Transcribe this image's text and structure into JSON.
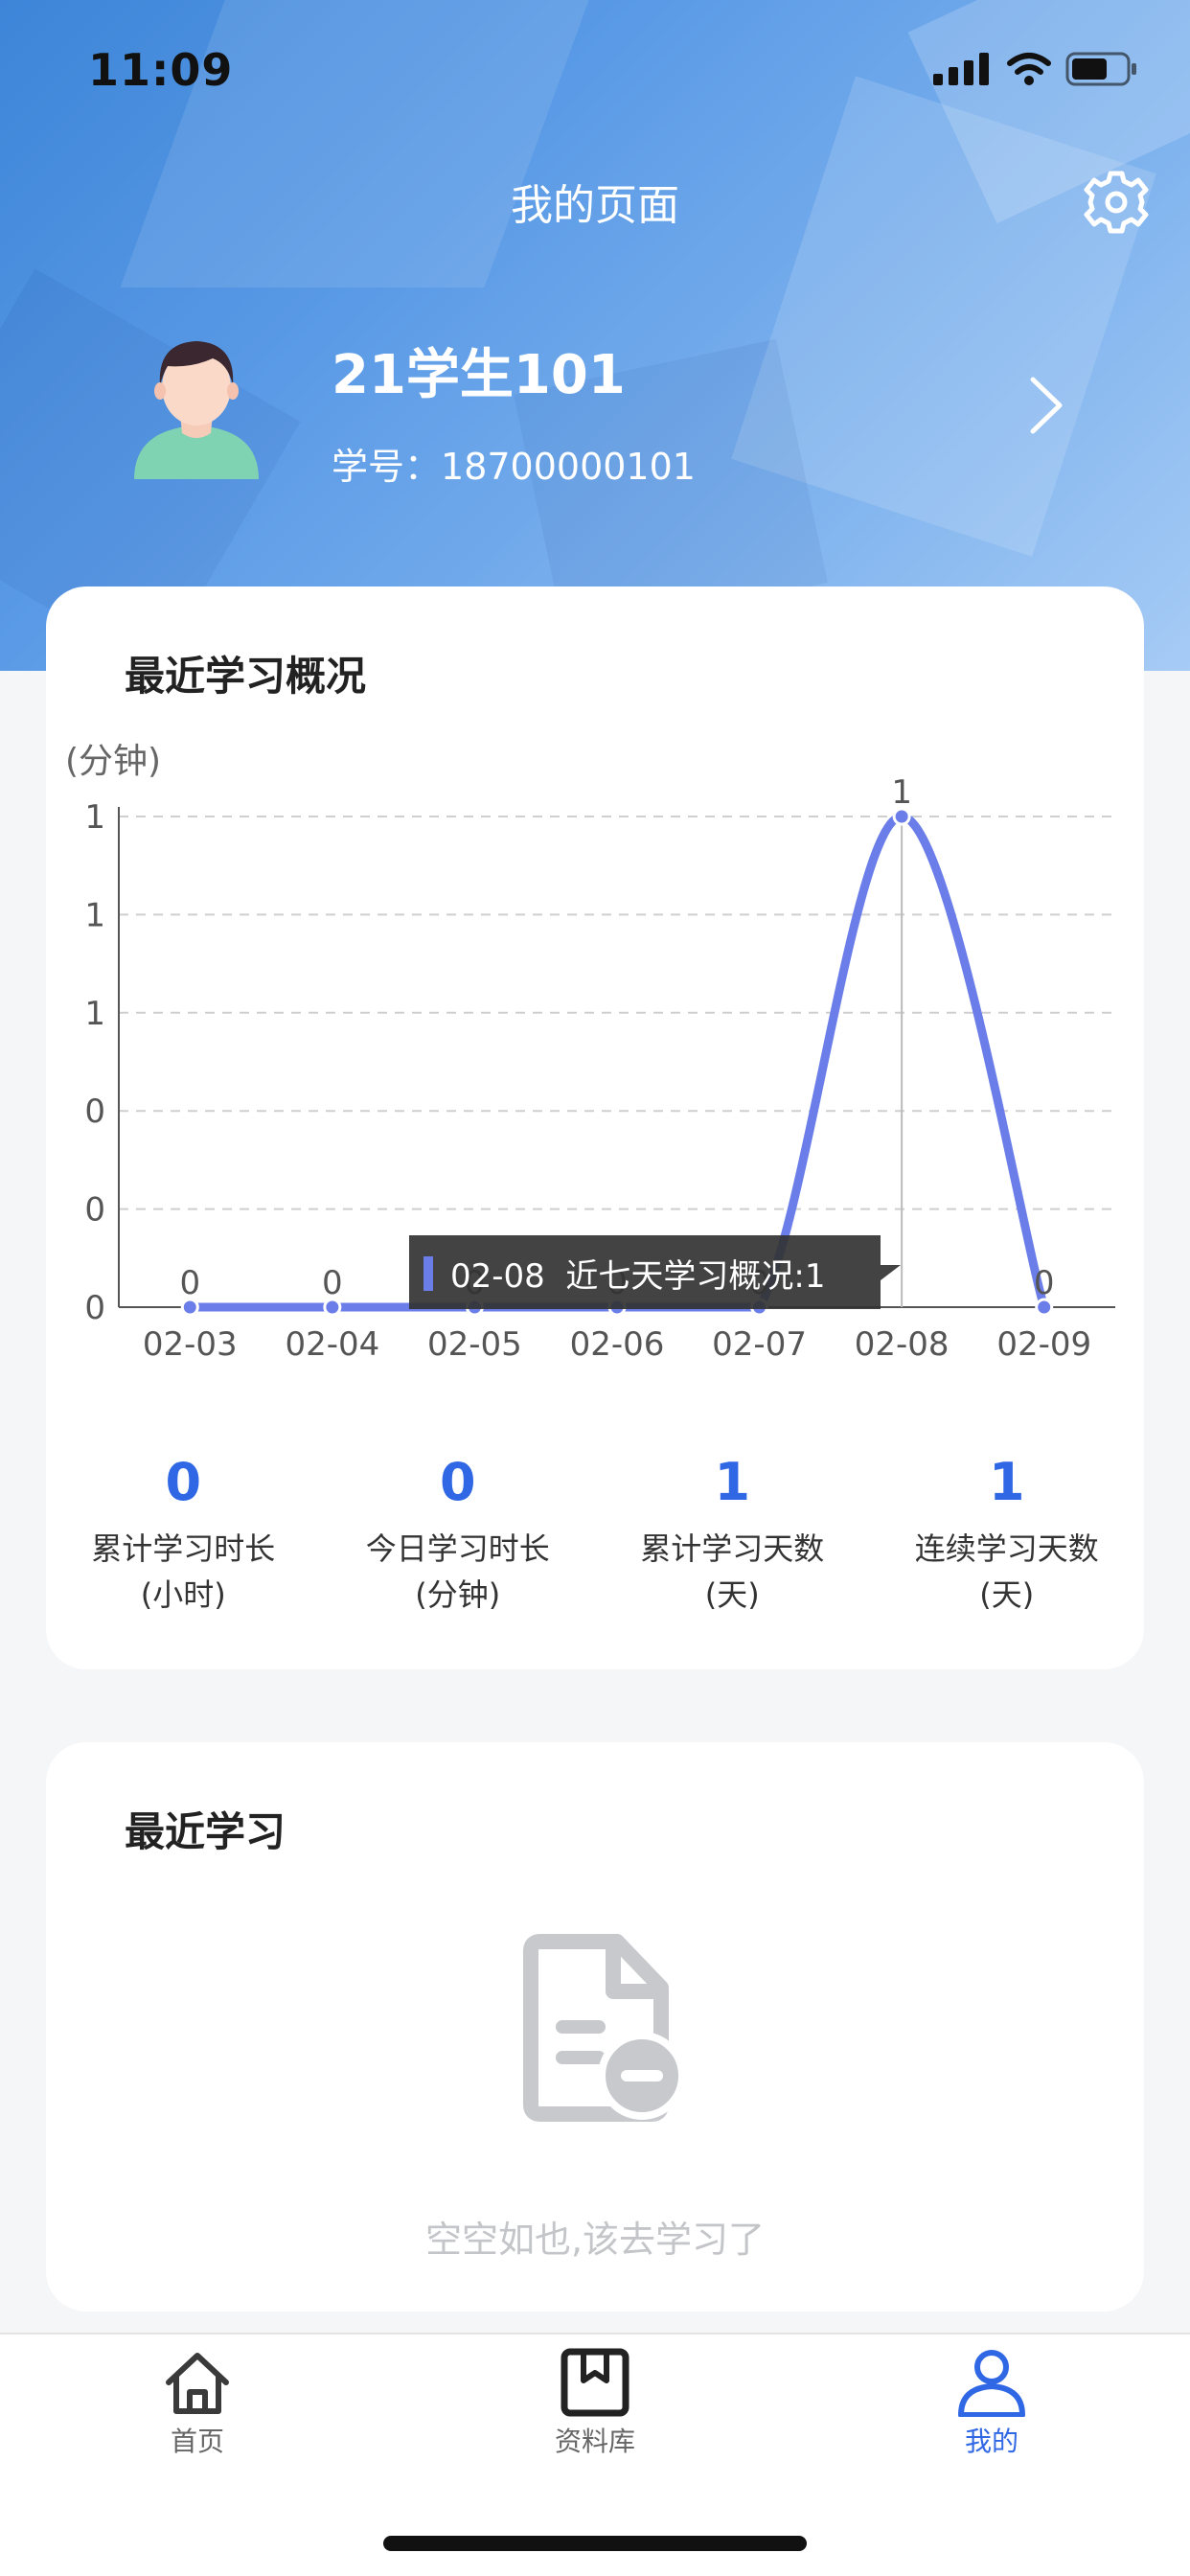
{
  "status_bar": {
    "time": "11:09"
  },
  "header": {
    "title": "我的页面",
    "user_name": "21学生101",
    "student_id_label": "学号：",
    "student_id": "18700000101"
  },
  "overview": {
    "title": "最近学习概况",
    "unit": "(分钟)",
    "tooltip": "02-08  近七天学习概况:1",
    "stats": [
      {
        "value": "0",
        "label": "累计学习时长",
        "unit": "(小时)"
      },
      {
        "value": "0",
        "label": "今日学习时长",
        "unit": "(分钟)"
      },
      {
        "value": "1",
        "label": "累计学习天数",
        "unit": "(天)"
      },
      {
        "value": "1",
        "label": "连续学习天数",
        "unit": "(天)"
      }
    ]
  },
  "recent": {
    "title": "最近学习",
    "empty_text": "空空如也,该去学习了"
  },
  "tabbar": {
    "items": [
      {
        "label": "首页",
        "icon": "home-icon",
        "active": false
      },
      {
        "label": "资料库",
        "icon": "bookmark-book-icon",
        "active": false
      },
      {
        "label": "我的",
        "icon": "user-icon",
        "active": true
      }
    ]
  },
  "colors": {
    "accent": "#2f67e4",
    "line": "#6a7de8",
    "header_from": "#3d85d8",
    "header_to": "#a6cbf5"
  },
  "chart_data": {
    "type": "line",
    "title": "",
    "ylabel": "(分钟)",
    "xlabel": "",
    "categories": [
      "02-03",
      "02-04",
      "02-05",
      "02-06",
      "02-07",
      "02-08",
      "02-09"
    ],
    "series": [
      {
        "name": "近七天学习概况",
        "values": [
          0,
          0,
          0,
          0,
          0,
          1,
          0
        ]
      }
    ],
    "ylim": [
      0,
      1
    ],
    "y_tick_labels": [
      "0",
      "0",
      "0",
      "1",
      "1",
      "1"
    ],
    "grid": true,
    "smooth": true,
    "data_labels": true,
    "highlighted": "02-08"
  }
}
